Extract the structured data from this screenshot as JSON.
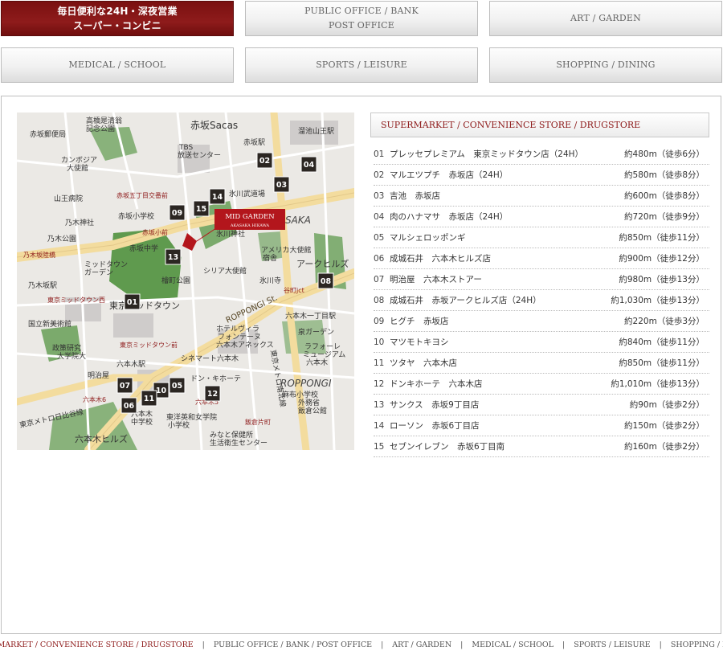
{
  "tabs": [
    {
      "id": "supermarket",
      "lines": [
        "毎日便利な24H・深夜営業",
        "スーパー・コンビニ"
      ],
      "active": true
    },
    {
      "id": "public",
      "lines": [
        "PUBLIC OFFICE / BANK",
        "POST OFFICE"
      ],
      "active": false
    },
    {
      "id": "art",
      "lines": [
        "ART / GARDEN"
      ],
      "active": false
    },
    {
      "id": "medical",
      "lines": [
        "MEDICAL / SCHOOL"
      ],
      "active": false
    },
    {
      "id": "sports",
      "lines": [
        "SPORTS / LEISURE"
      ],
      "active": false
    },
    {
      "id": "shopping",
      "lines": [
        "SHOPPING / DINING"
      ],
      "active": false
    }
  ],
  "category_title": "SUPERMARKET / CONVENIENCE STORE / DRUGSTORE",
  "map": {
    "property_name": "MID GARDEN",
    "property_sub": "AKASAKA HIKAWA",
    "area_labels": [
      "赤坂Sacas",
      "赤坂駅",
      "溜池山王駅",
      "TBS",
      "放送センター",
      "高橋是清翁",
      "記念公園",
      "赤坂郵便局",
      "カンボジア",
      "大使館",
      "山王病院",
      "乃木神社",
      "乃木公園",
      "乃木坂陸橋",
      "乃木坂駅",
      "ミッドタウン",
      "ガーデン",
      "東京ミッドタウン",
      "東京ミッドタウン西",
      "国立新美術館",
      "政策研究",
      "大学院大",
      "赤坂小学校",
      "赤坂中学",
      "赤坂小前",
      "赤坂五丁目交番前",
      "氷川武道場",
      "氷川神社",
      "アメリカ大使館",
      "宿舎",
      "シリア大使館",
      "檜町公園",
      "SAKA",
      "アークヒルズ",
      "氷川寺",
      "谷町jct",
      "六本木一丁目駅",
      "泉ガーデン",
      "ホテルヴィラ",
      "フォンテーヌ",
      "六本木アネックス",
      "ラフォーレ",
      "ミュージアム",
      "六本木",
      "ROPPONGI St.",
      "ROPPONGI",
      "東京ミッドタウン前",
      "六本木駅",
      "明治屋",
      "六本木6",
      "六本木5",
      "シネマート六本木",
      "ドン・キホーテ",
      "東京メトロ南北線",
      "麻布小学校",
      "外務省",
      "飯倉公館",
      "飯倉片町",
      "東京メトロ日比谷線",
      "六本木中学校",
      "東洋英和女学院",
      "小学校",
      "みなと保健所",
      "生活衛生センター",
      "六本木ヒルズ"
    ],
    "markers": [
      "01",
      "02",
      "03",
      "04",
      "05",
      "06",
      "07",
      "08",
      "09",
      "10",
      "11",
      "12",
      "13",
      "14",
      "15"
    ]
  },
  "stores": [
    {
      "num": "01",
      "name": "プレッセプレミアム　東京ミッドタウン店（24H）",
      "distance": "約480m（徒歩6分）"
    },
    {
      "num": "02",
      "name": "マルエツプチ　赤坂店（24H）",
      "distance": "約580m（徒歩8分）"
    },
    {
      "num": "03",
      "name": "吉池　赤坂店",
      "distance": "約600m（徒歩8分）"
    },
    {
      "num": "04",
      "name": "肉のハナマサ　赤坂店（24H）",
      "distance": "約720m（徒歩9分）"
    },
    {
      "num": "05",
      "name": "マルシェロッポンギ",
      "distance": "約850m（徒歩11分）"
    },
    {
      "num": "06",
      "name": "成城石井　六本木ヒルズ店",
      "distance": "約900m（徒歩12分）"
    },
    {
      "num": "07",
      "name": "明治屋　六本木ストアー",
      "distance": "約980m（徒歩13分）"
    },
    {
      "num": "08",
      "name": "成城石井　赤坂アークヒルズ店（24H）",
      "distance": "約1,030m（徒歩13分）"
    },
    {
      "num": "09",
      "name": "ヒグチ　赤坂店",
      "distance": "約220m（徒歩3分）"
    },
    {
      "num": "10",
      "name": "マツモトキヨシ",
      "distance": "約840m（徒歩11分）"
    },
    {
      "num": "11",
      "name": "ツタヤ　六本木店",
      "distance": "約850m（徒歩11分）"
    },
    {
      "num": "12",
      "name": "ドンキホーテ　六本木店",
      "distance": "約1,010m（徒歩13分）"
    },
    {
      "num": "13",
      "name": "サンクス　赤坂9丁目店",
      "distance": "約90m（徒歩2分）"
    },
    {
      "num": "14",
      "name": "ローソン　赤坂6丁目店",
      "distance": "約150m（徒歩2分）"
    },
    {
      "num": "15",
      "name": "セブンイレブン　赤坂6丁目南",
      "distance": "約160m（徒歩2分）"
    }
  ],
  "bottom_nav": [
    {
      "label": "SUPERMARKET / CONVENIENCE STORE / DRUGSTORE",
      "active": true
    },
    {
      "label": "PUBLIC OFFICE / BANK / POST OFFICE",
      "active": false
    },
    {
      "label": "ART / GARDEN",
      "active": false
    },
    {
      "label": "MEDICAL / SCHOOL",
      "active": false
    },
    {
      "label": "SPORTS / LEISURE",
      "active": false
    },
    {
      "label": "SHOPPING / DINING",
      "active": false
    }
  ],
  "colors": {
    "accent": "#8e1b1b",
    "marker": "#2b2622",
    "map_bg": "#eceae6",
    "park": "#5f9a4e",
    "road": "#f3dc9e"
  }
}
